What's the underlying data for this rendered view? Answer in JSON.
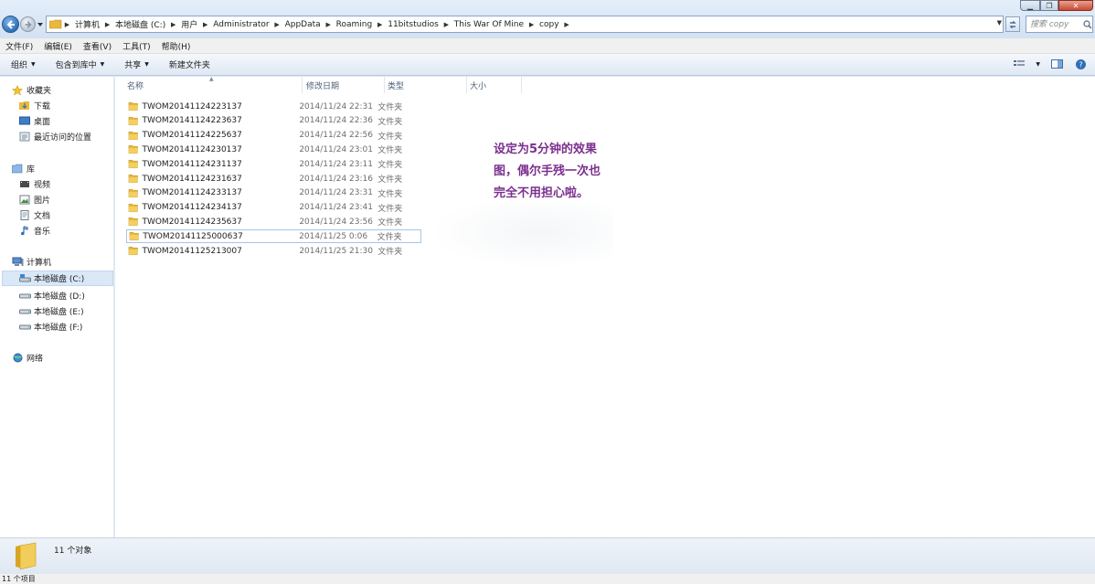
{
  "address": {
    "breadcrumbs": [
      "计算机",
      "本地磁盘 (C:)",
      "用户",
      "Administrator",
      "AppData",
      "Roaming",
      "11bitstudios",
      "This War Of Mine",
      "copy"
    ]
  },
  "search": {
    "placeholder": "搜索 copy"
  },
  "menu": {
    "items": [
      "文件(F)",
      "编辑(E)",
      "查看(V)",
      "工具(T)",
      "帮助(H)"
    ]
  },
  "toolbar": {
    "organize": "组织",
    "include_library": "包含到库中",
    "share": "共享",
    "new_folder": "新建文件夹"
  },
  "nav": {
    "favorites": "收藏夹",
    "fav_items": [
      "下载",
      "桌面",
      "最近访问的位置"
    ],
    "libraries": "库",
    "lib_items": [
      "视频",
      "图片",
      "文档",
      "音乐"
    ],
    "computer": "计算机",
    "drives": [
      "本地磁盘 (C:)",
      "本地磁盘 (D:)",
      "本地磁盘 (E:)",
      "本地磁盘 (F:)"
    ],
    "network": "网络"
  },
  "columns": {
    "name": "名称",
    "date": "修改日期",
    "type": "类型",
    "size": "大小"
  },
  "files": [
    {
      "name": "TWOM20141124223137",
      "date": "2014/11/24 22:31",
      "type": "文件夹"
    },
    {
      "name": "TWOM20141124223637",
      "date": "2014/11/24 22:36",
      "type": "文件夹"
    },
    {
      "name": "TWOM20141124225637",
      "date": "2014/11/24 22:56",
      "type": "文件夹"
    },
    {
      "name": "TWOM20141124230137",
      "date": "2014/11/24 23:01",
      "type": "文件夹"
    },
    {
      "name": "TWOM20141124231137",
      "date": "2014/11/24 23:11",
      "type": "文件夹"
    },
    {
      "name": "TWOM20141124231637",
      "date": "2014/11/24 23:16",
      "type": "文件夹"
    },
    {
      "name": "TWOM20141124233137",
      "date": "2014/11/24 23:31",
      "type": "文件夹"
    },
    {
      "name": "TWOM20141124234137",
      "date": "2014/11/24 23:41",
      "type": "文件夹"
    },
    {
      "name": "TWOM20141124235637",
      "date": "2014/11/24 23:56",
      "type": "文件夹"
    },
    {
      "name": "TWOM20141125000637",
      "date": "2014/11/25 0:06",
      "type": "文件夹"
    },
    {
      "name": "TWOM20141125213007",
      "date": "2014/11/25 21:30",
      "type": "文件夹"
    }
  ],
  "annotation": {
    "lines": [
      "设定为5分钟的效果",
      "图，偶尔手残一次也",
      "完全不用担心啦。"
    ]
  },
  "details": {
    "text": "11 个对象"
  },
  "status": {
    "text": "11 个项目"
  },
  "colors": {
    "annotation": "#7b2f8e",
    "folder": "#e8b93a",
    "accent": "#2f6fb7"
  }
}
